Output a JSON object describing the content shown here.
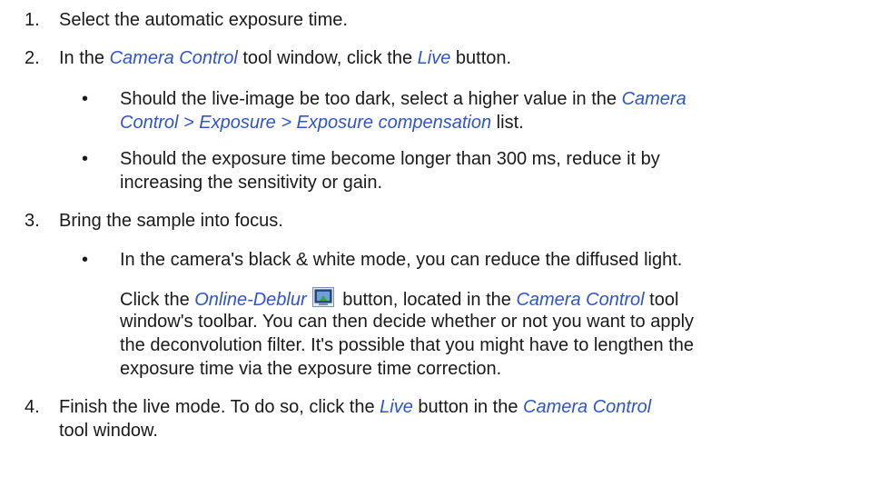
{
  "steps": [
    {
      "num": "1.",
      "text": "Select the automatic exposure time."
    },
    {
      "num": "2.",
      "parts": [
        "In the ",
        "Camera Control",
        " tool window, click the ",
        "Live",
        " button."
      ]
    },
    {
      "num": "3.",
      "text": "Bring the sample into focus."
    },
    {
      "num": "4.",
      "parts": [
        "Finish the live mode. To do so, click the ",
        "Live",
        " button in the ",
        "Camera Control"
      ],
      "cont": "tool window."
    }
  ],
  "bullets_step2": [
    {
      "parts": [
        "Should the live-image be too dark, select a higher value in the ",
        "Camera"
      ],
      "line2": [
        "Control > Exposure > Exposure compensation",
        " list."
      ]
    },
    {
      "line1": "Should the exposure time become longer than 300 ms, reduce it by",
      "line2": "increasing the sensitivity or gain."
    }
  ],
  "bullet_step3": {
    "text": "In the camera's black & white mode, you can reduce the diffused light.",
    "para": [
      "Click the ",
      "Online-Deblur",
      " button, located in the ",
      "Camera Control",
      " tool"
    ],
    "para_lines": [
      "window's toolbar. You can then decide whether or not you want to apply",
      "the deconvolution filter. It's possible that you might have to lengthen the",
      "exposure time via the exposure time correction."
    ]
  },
  "bullet_symbol": "•",
  "icons": {
    "deblur": "online-deblur-icon"
  },
  "colors": {
    "emphasis": "#2f55c8",
    "text": "#1a1a1a"
  }
}
